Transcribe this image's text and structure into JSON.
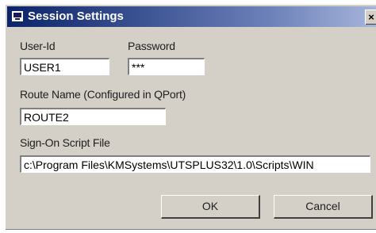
{
  "window": {
    "title": "Session Settings",
    "close_glyph": "×"
  },
  "fields": {
    "user_id": {
      "label": "User-Id",
      "value": "USER1"
    },
    "password": {
      "label": "Password",
      "value": "***"
    },
    "route_name": {
      "label": "Route Name (Configured in QPort)",
      "value": "ROUTE2"
    },
    "signon_script": {
      "label": "Sign-On Script File",
      "value": "c:\\Program Files\\KMSystems\\UTSPLUS32\\1.0\\Scripts\\WIN"
    }
  },
  "buttons": {
    "ok": "OK",
    "cancel": "Cancel"
  }
}
